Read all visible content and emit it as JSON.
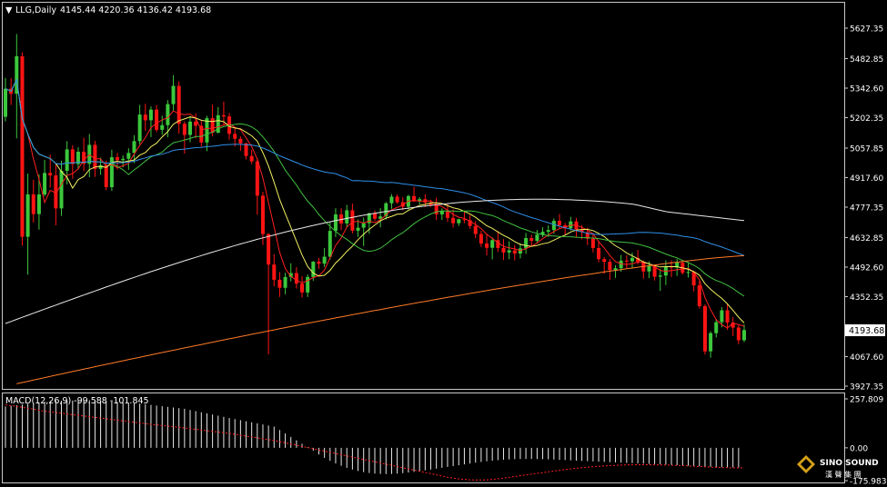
{
  "header": {
    "symbol": "LLG,Daily",
    "ohlc": "4145.44 4220.36 4136.42 4193.68"
  },
  "macd_header": "MACD(12,26,9) -99.588 -101.845",
  "current_price": "4193.68",
  "logo": {
    "name": "SINO SOUND",
    "cjk": "漢 聲 集 團"
  },
  "colors": {
    "background": "#000000",
    "frame": "#c8c8c8",
    "bull": "#3cc83c",
    "bear": "#ff1414",
    "ma_fast": "#ff2020",
    "ma_yellow": "#f0f060",
    "ma_green": "#40c040",
    "ma_blue": "#2f8fe8",
    "ma_white": "#e8e8e8",
    "ma_orange": "#ff7a28",
    "macd_hist": "#e8e8e8",
    "macd_signal": "#ff2020"
  },
  "chart_data": [
    {
      "type": "candlestick",
      "title": "LLG,Daily",
      "y_ticks": [
        5627.35,
        5482.85,
        5342.6,
        5202.35,
        5057.85,
        4917.6,
        4777.35,
        4632.85,
        4492.6,
        4352.35,
        4067.6,
        3927.35
      ],
      "y_tick_labels": [
        "5627.35",
        "5482.85",
        "5342.60",
        "5202.35",
        "5057.85",
        "4917.60",
        "4777.35",
        "4632.85",
        "4492.60",
        "4352.35",
        "4067.60",
        "3927.35"
      ],
      "ylim": [
        3927.35,
        5627.35
      ],
      "last_price": 4193.68,
      "grid": false,
      "candles": [
        [
          5206.6,
          5390.5,
          5185.1,
          5339.8
        ],
        [
          5339.8,
          5391.0,
          5262.8,
          5315.8
        ],
        [
          5315.8,
          5599.7,
          5103.8,
          5493.9
        ],
        [
          5493.9,
          5512.4,
          4594.6,
          4636.7
        ],
        [
          4636.7,
          4937.0,
          4456.7,
          4838.1
        ],
        [
          4838.1,
          4907.0,
          4704.6,
          4744.5
        ],
        [
          4744.5,
          4932.1,
          4670.7,
          4837.7
        ],
        [
          4837.7,
          5001.7,
          4829.1,
          4939.7
        ],
        [
          4939.7,
          5026.9,
          4870.6,
          4928.1
        ],
        [
          4928.1,
          4984.5,
          4691.1,
          4771.6
        ],
        [
          4771.6,
          4998.3,
          4735.3,
          4950.0
        ],
        [
          4950.0,
          5090.8,
          4885.6,
          5051.6
        ],
        [
          5051.6,
          5071.5,
          4912.0,
          4982.2
        ],
        [
          4982.2,
          5061.9,
          4955.8,
          5040.6
        ],
        [
          5040.6,
          5107.2,
          4947.5,
          4983.1
        ],
        [
          4983.1,
          5124.4,
          4919.6,
          5073.1
        ],
        [
          5073.1,
          5092.5,
          4921.3,
          4959.1
        ],
        [
          4959.1,
          5012.6,
          4931.7,
          4976.3
        ],
        [
          4976.3,
          4998.6,
          4858.8,
          4872.4
        ],
        [
          4872.4,
          5050.1,
          4854.3,
          5014.3
        ],
        [
          5014.3,
          5034.3,
          4955.6,
          5000.7
        ],
        [
          5000.7,
          5023.5,
          4966.6,
          5007.0
        ],
        [
          5007.0,
          5056.8,
          4954.6,
          5035.0
        ],
        [
          5035.0,
          5119.2,
          4986.3,
          5091.0
        ],
        [
          5091.0,
          5262.8,
          5074.2,
          5217.0
        ],
        [
          5217.0,
          5268.1,
          5140.2,
          5189.8
        ],
        [
          5189.8,
          5255.5,
          5110.0,
          5240.5
        ],
        [
          5240.5,
          5262.2,
          5133.8,
          5144.8
        ],
        [
          5144.8,
          5211.6,
          5121.0,
          5166.9
        ],
        [
          5166.9,
          5285.5,
          5108.7,
          5266.7
        ],
        [
          5266.7,
          5403.5,
          5234.4,
          5353.2
        ],
        [
          5353.2,
          5374.3,
          5126.3,
          5173.1
        ],
        [
          5173.1,
          5185.2,
          5031.8,
          5120.4
        ],
        [
          5120.4,
          5209.8,
          5085.7,
          5183.7
        ],
        [
          5183.7,
          5222.6,
          5104.5,
          5163.8
        ],
        [
          5163.8,
          5186.0,
          5064.4,
          5084.6
        ],
        [
          5084.6,
          5211.1,
          5043.2,
          5199.8
        ],
        [
          5199.8,
          5263.9,
          5113.9,
          5131.2
        ],
        [
          5131.2,
          5252.3,
          5127.7,
          5213.9
        ],
        [
          5213.9,
          5278.8,
          5168.4,
          5208.0
        ],
        [
          5208.0,
          5224.2,
          5097.9,
          5125.3
        ],
        [
          5125.3,
          5155.8,
          5065.0,
          5101.8
        ],
        [
          5101.8,
          5113.4,
          5044.6,
          5080.4
        ],
        [
          5080.4,
          5083.5,
          5004.0,
          5020.4
        ],
        [
          5020.4,
          5050.1,
          4981.8,
          4994.8
        ],
        [
          4994.8,
          5008.8,
          4741.6,
          4831.9
        ],
        [
          4831.9,
          4850.4,
          4597.9,
          4650.0
        ],
        [
          4650.0,
          4653.1,
          4078.8,
          4504.7
        ],
        [
          4504.7,
          4554.7,
          4401.2,
          4432.5
        ],
        [
          4432.5,
          4469.3,
          4351.0,
          4394.4
        ],
        [
          4394.4,
          4465.9,
          4363.4,
          4445.5
        ],
        [
          4445.5,
          4511.0,
          4424.4,
          4464.3
        ],
        [
          4464.3,
          4492.1,
          4390.7,
          4414.1
        ],
        [
          4414.1,
          4449.7,
          4348.0,
          4372.1
        ],
        [
          4372.1,
          4458.0,
          4350.7,
          4445.8
        ],
        [
          4445.8,
          4521.5,
          4427.6,
          4518.3
        ],
        [
          4518.3,
          4536.5,
          4484.6,
          4509.1
        ],
        [
          4509.1,
          4583.6,
          4493.7,
          4542.0
        ],
        [
          4542.0,
          4707.0,
          4528.7,
          4664.7
        ],
        [
          4664.7,
          4772.2,
          4635.4,
          4742.7
        ],
        [
          4742.7,
          4772.4,
          4668.1,
          4700.0
        ],
        [
          4700.0,
          4788.0,
          4680.9,
          4762.4
        ],
        [
          4762.4,
          4794.7,
          4652.6,
          4665.6
        ],
        [
          4665.6,
          4719.0,
          4635.5,
          4679.7
        ],
        [
          4679.7,
          4727.8,
          4592.6,
          4701.4
        ],
        [
          4701.4,
          4751.2,
          4650.7,
          4747.9
        ],
        [
          4747.9,
          4761.8,
          4711.7,
          4722.3
        ],
        [
          4722.3,
          4772.0,
          4681.4,
          4733.4
        ],
        [
          4733.4,
          4801.4,
          4718.6,
          4795.9
        ],
        [
          4795.9,
          4839.4,
          4769.9,
          4827.1
        ],
        [
          4827.1,
          4838.4,
          4792.8,
          4800.8
        ],
        [
          4800.8,
          4824.6,
          4762.4,
          4779.5
        ],
        [
          4779.5,
          4836.7,
          4766.5,
          4829.9
        ],
        [
          4829.9,
          4874.0,
          4802.0,
          4804.7
        ],
        [
          4804.7,
          4824.8,
          4790.5,
          4815.4
        ],
        [
          4815.4,
          4839.3,
          4777.7,
          4799.2
        ],
        [
          4799.2,
          4812.7,
          4779.5,
          4787.3
        ],
        [
          4787.3,
          4822.4,
          4715.7,
          4743.0
        ],
        [
          4743.0,
          4772.0,
          4717.1,
          4757.6
        ],
        [
          4757.6,
          4795.0,
          4707.4,
          4726.5
        ],
        [
          4726.5,
          4767.2,
          4680.2,
          4701.0
        ],
        [
          4701.0,
          4722.1,
          4687.9,
          4720.2
        ],
        [
          4720.2,
          4759.1,
          4701.9,
          4715.5
        ],
        [
          4715.5,
          4739.8,
          4673.9,
          4688.0
        ],
        [
          4688.0,
          4711.3,
          4629.7,
          4649.8
        ],
        [
          4649.8,
          4665.1,
          4588.1,
          4604.4
        ],
        [
          4604.4,
          4651.8,
          4547.6,
          4584.4
        ],
        [
          4584.4,
          4633.4,
          4529.2,
          4620.9
        ],
        [
          4620.9,
          4663.8,
          4565.1,
          4583.6
        ],
        [
          4583.6,
          4625.6,
          4526.2,
          4562.0
        ],
        [
          4562.0,
          4615.3,
          4530.0,
          4572.1
        ],
        [
          4572.1,
          4597.2,
          4524.1,
          4557.2
        ],
        [
          4557.2,
          4606.2,
          4534.1,
          4581.5
        ],
        [
          4581.5,
          4655.1,
          4556.1,
          4630.6
        ],
        [
          4630.6,
          4646.5,
          4594.6,
          4617.6
        ],
        [
          4617.6,
          4669.4,
          4609.4,
          4647.0
        ],
        [
          4647.0,
          4681.9,
          4635.1,
          4660.4
        ],
        [
          4660.4,
          4691.2,
          4636.2,
          4668.7
        ],
        [
          4668.7,
          4724.0,
          4651.0,
          4712.2
        ],
        [
          4712.2,
          4745.1,
          4675.5,
          4691.2
        ],
        [
          4691.2,
          4702.4,
          4645.0,
          4676.6
        ],
        [
          4676.6,
          4731.8,
          4665.9,
          4709.8
        ],
        [
          4709.8,
          4726.7,
          4634.6,
          4670.7
        ],
        [
          4670.7,
          4692.0,
          4624.6,
          4658.0
        ],
        [
          4658.0,
          4679.3,
          4597.5,
          4627.7
        ],
        [
          4627.7,
          4650.0,
          4562.1,
          4583.2
        ],
        [
          4583.2,
          4613.4,
          4515.9,
          4530.5
        ],
        [
          4530.5,
          4540.8,
          4460.7,
          4517.6
        ],
        [
          4517.6,
          4530.4,
          4432.1,
          4478.7
        ],
        [
          4478.7,
          4502.1,
          4441.6,
          4487.4
        ],
        [
          4487.4,
          4550.7,
          4470.9,
          4523.2
        ],
        [
          4523.2,
          4548.7,
          4486.9,
          4520.2
        ],
        [
          4520.2,
          4561.4,
          4488.3,
          4536.3
        ],
        [
          4536.3,
          4574.3,
          4505.8,
          4517.4
        ],
        [
          4517.4,
          4524.1,
          4437.8,
          4472.0
        ],
        [
          4472.0,
          4520.0,
          4440.1,
          4497.8
        ],
        [
          4497.8,
          4505.4,
          4428.6,
          4447.0
        ],
        [
          4447.0,
          4484.4,
          4379.7,
          4452.6
        ],
        [
          4452.6,
          4524.9,
          4407.1,
          4495.1
        ],
        [
          4495.1,
          4525.0,
          4444.9,
          4491.0
        ],
        [
          4491.0,
          4532.0,
          4450.7,
          4513.8
        ],
        [
          4513.8,
          4522.2,
          4457.4,
          4465.5
        ],
        [
          4465.5,
          4511.3,
          4442.9,
          4469.2
        ],
        [
          4469.2,
          4475.1,
          4377.1,
          4405.7
        ],
        [
          4405.7,
          4426.4,
          4296.3,
          4307.2
        ],
        [
          4307.2,
          4315.6,
          4077.4,
          4092.8
        ],
        [
          4092.8,
          4187.7,
          4062.4,
          4179.1
        ],
        [
          4179.1,
          4245.9,
          4158.8,
          4231.2
        ],
        [
          4231.2,
          4302.4,
          4207.2,
          4287.5
        ],
        [
          4287.5,
          4317.6,
          4194.6,
          4229.5
        ],
        [
          4229.5,
          4255.1,
          4165.3,
          4205.4
        ],
        [
          4205.4,
          4219.6,
          4126.7,
          4145.4
        ],
        [
          4145.4,
          4220.4,
          4136.4,
          4193.7
        ]
      ]
    },
    {
      "type": "macd",
      "title": "MACD(12,26,9)",
      "macd_value": -99.588,
      "signal_value": -101.845,
      "y_tick_labels": [
        "257.809",
        "0.00",
        "-175.983"
      ],
      "ylim": [
        -175.983,
        257.809
      ],
      "macd": [
        210.0,
        213.5,
        217.0,
        220.5,
        224.0,
        227.5,
        231.0,
        234.5,
        238.0,
        238.5,
        239.0,
        239.5,
        239.9,
        240.4,
        240.9,
        241.4,
        241.9,
        239.8,
        237.5,
        235.3,
        233.2,
        231.0,
        228.8,
        226.6,
        224.4,
        221.1,
        217.8,
        214.6,
        211.3,
        208.0,
        204.8,
        201.5,
        198.2,
        192.2,
        186.4,
        180.6,
        174.8,
        169.0,
        163.2,
        157.3,
        151.4,
        146.0,
        140.5,
        135.0,
        129.6,
        124.1,
        118.6,
        113.2,
        107.7,
        90.3,
        72.9,
        55.4,
        38.0,
        20.6,
        3.1,
        -14.3,
        -33.7,
        -50.8,
        -66.0,
        -79.3,
        -91.2,
        -101.6,
        -110.3,
        -117.6,
        -123.4,
        -127.9,
        -131.0,
        -132.7,
        -133.3,
        -132.7,
        -131.2,
        -128.7,
        -125.6,
        -122.1,
        -118.4,
        -114.3,
        -110.3,
        -106.0,
        -101.6,
        -97.3,
        -92.8,
        -88.5,
        -84.1,
        -79.8,
        -75.7,
        -71.8,
        -68.4,
        -65.2,
        -62.6,
        -60.4,
        -58.8,
        -57.6,
        -56.8,
        -56.5,
        -56.6,
        -57.0,
        -57.6,
        -58.5,
        -59.6,
        -61.0,
        -62.4,
        -63.8,
        -65.2,
        -66.5,
        -67.8,
        -69.0,
        -70.3,
        -71.6,
        -72.9,
        -74.1,
        -75.3,
        -76.6,
        -77.7,
        -79.0,
        -80.2,
        -81.5,
        -82.7,
        -84.0,
        -85.3,
        -86.8,
        -88.2,
        -89.8,
        -91.3,
        -92.6,
        -94.0,
        -95.4,
        -96.7,
        -97.7,
        -98.6,
        -99.2,
        -99.5,
        -99.6
      ],
      "signal": [
        218.0,
        214.0,
        210.0,
        205.5,
        201.0,
        196.0,
        191.0,
        186.0,
        182.5,
        179.0,
        175.5,
        172.0,
        168.5,
        165.0,
        161.5,
        158.0,
        154.5,
        151.0,
        147.5,
        144.0,
        140.5,
        137.0,
        133.5,
        130.0,
        126.5,
        123.0,
        119.5,
        116.0,
        113.0,
        110.0,
        107.0,
        104.0,
        101.0,
        97.5,
        94.0,
        90.5,
        87.0,
        83.5,
        80.0,
        76.5,
        73.0,
        68.5,
        64.0,
        59.5,
        55.0,
        50.5,
        46.0,
        41.5,
        37.0,
        31.0,
        25.0,
        19.0,
        13.0,
        7.0,
        1.0,
        -5.0,
        -11.0,
        -17.0,
        -23.0,
        -29.0,
        -35.0,
        -41.0,
        -47.0,
        -53.0,
        -59.0,
        -65.0,
        -71.0,
        -77.0,
        -83.0,
        -89.0,
        -95.0,
        -101.0,
        -107.0,
        -113.0,
        -119.0,
        -125.0,
        -131.0,
        -137.0,
        -143.0,
        -149.0,
        -154.0,
        -158.0,
        -160.5,
        -162.5,
        -163.5,
        -163.5,
        -162.5,
        -160.5,
        -157.5,
        -154.0,
        -150.0,
        -146.0,
        -142.0,
        -138.0,
        -134.0,
        -130.0,
        -126.0,
        -122.0,
        -118.0,
        -114.0,
        -110.5,
        -107.0,
        -104.0,
        -101.0,
        -98.5,
        -96.0,
        -94.0,
        -92.0,
        -90.5,
        -89.0,
        -88.0,
        -87.0,
        -86.5,
        -86.0,
        -86.0,
        -86.0,
        -86.5,
        -87.0,
        -87.5,
        -88.5,
        -89.5,
        -90.5,
        -92.0,
        -93.5,
        -95.0,
        -96.5,
        -98.0,
        -99.5,
        -100.5,
        -101.0,
        -101.5,
        -101.8,
        -101.8
      ]
    }
  ]
}
